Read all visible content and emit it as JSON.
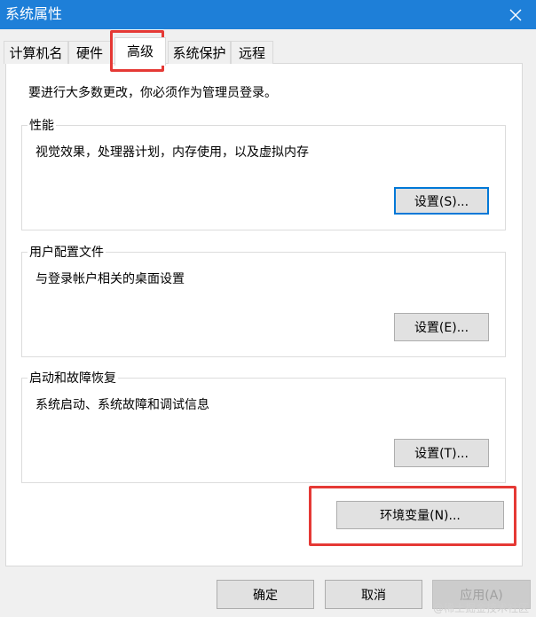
{
  "window": {
    "title": "系统属性",
    "close_icon": "close-icon"
  },
  "tabs": [
    {
      "label": "计算机名"
    },
    {
      "label": "硬件"
    },
    {
      "label": "高级",
      "active": true
    },
    {
      "label": "系统保护"
    },
    {
      "label": "远程"
    }
  ],
  "main": {
    "intro": "要进行大多数更改，你必须作为管理员登录。",
    "performance": {
      "title": "性能",
      "desc": "视觉效果，处理器计划，内存使用，以及虚拟内存",
      "button": "设置(S)..."
    },
    "profile": {
      "title": "用户配置文件",
      "desc": "与登录帐户相关的桌面设置",
      "button": "设置(E)..."
    },
    "startup": {
      "title": "启动和故障恢复",
      "desc": "系统启动、系统故障和调试信息",
      "button": "设置(T)..."
    },
    "env_button": "环境变量(N)..."
  },
  "footer": {
    "ok": "确定",
    "cancel": "取消",
    "apply": "应用(A)"
  },
  "watermark": "@稀土掘金技术社区",
  "colors": {
    "titlebar": "#1e7fd8",
    "highlight": "#e53935",
    "focus": "#0078d7"
  }
}
